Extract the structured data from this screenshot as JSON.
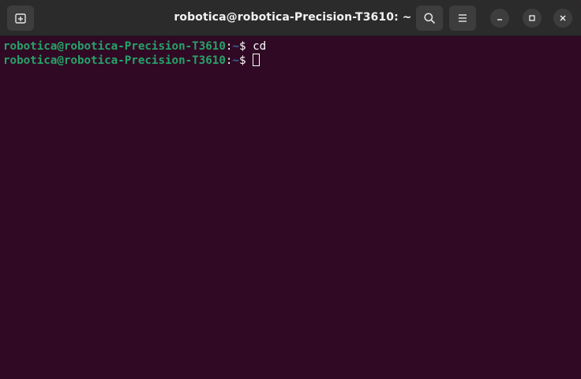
{
  "window": {
    "title": "robotica@robotica-Precision-T3610: ~"
  },
  "header": {
    "new_tab_icon": "new-tab-icon",
    "search_icon": "search-icon",
    "menu_icon": "hamburger-menu-icon",
    "minimize_icon": "minimize-icon",
    "maximize_icon": "maximize-icon",
    "close_icon": "close-icon"
  },
  "terminal": {
    "lines": [
      {
        "user_host": "robotica@robotica-Precision-T3610",
        "colon": ":",
        "path": "~",
        "prompt": "$ ",
        "command": "cd"
      },
      {
        "user_host": "robotica@robotica-Precision-T3610",
        "colon": ":",
        "path": "~",
        "prompt": "$ ",
        "command": ""
      }
    ]
  },
  "colors": {
    "background": "#300a24",
    "titlebar": "#2b2b2b",
    "user_host": "#26a269",
    "path": "#3465a4",
    "text": "#ffffff"
  }
}
